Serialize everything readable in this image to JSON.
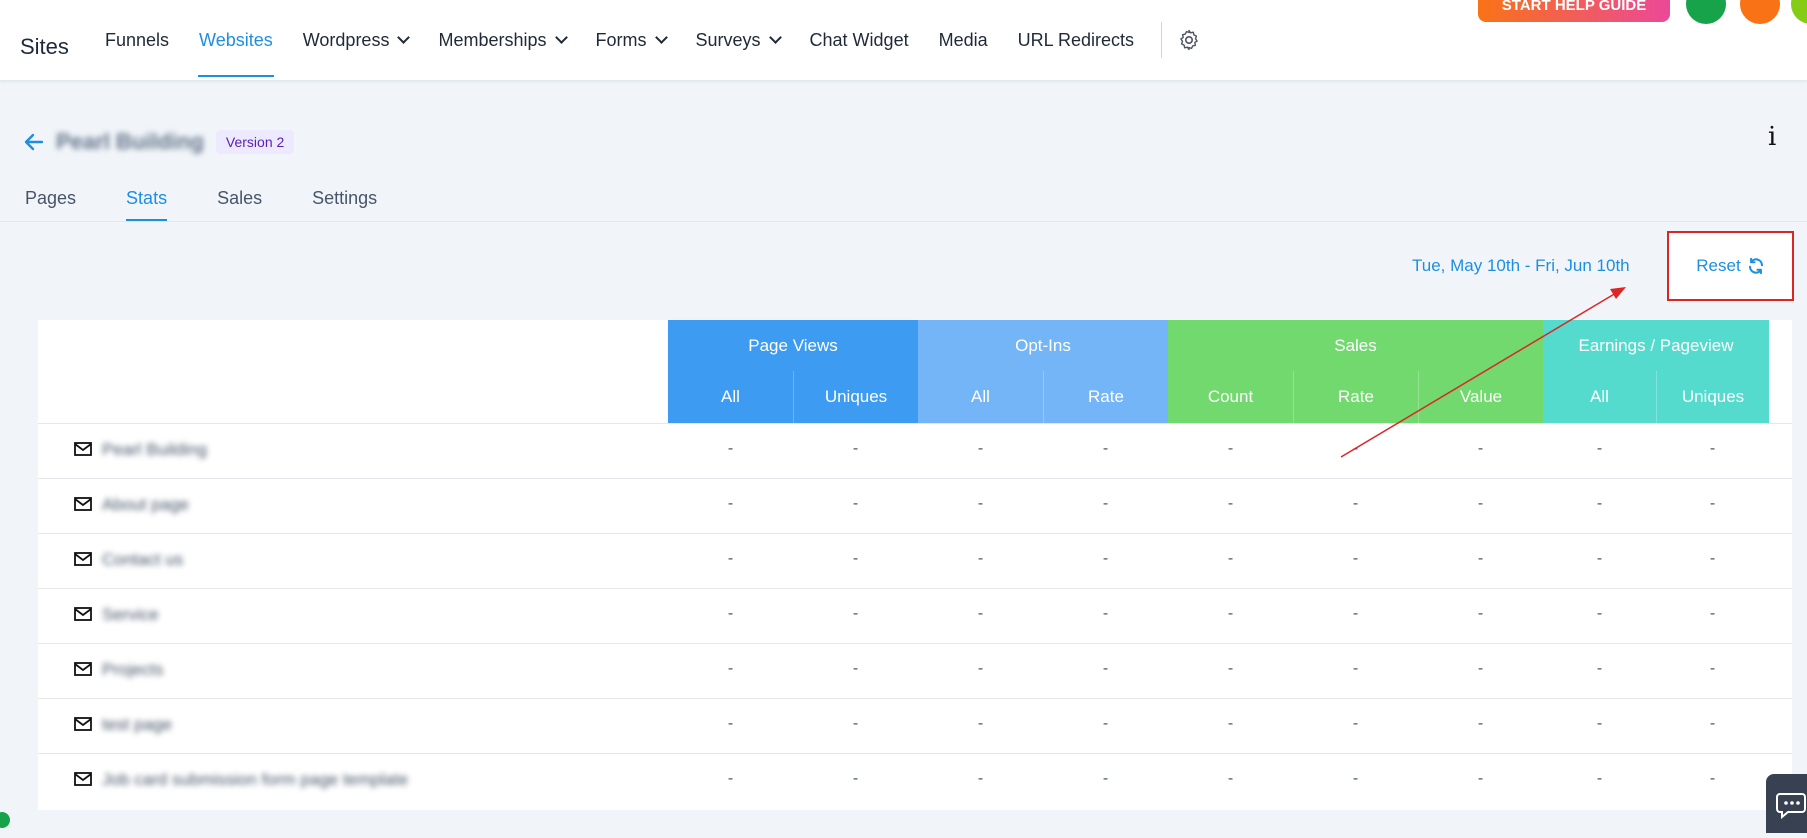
{
  "topbar": {
    "brand": "Sites",
    "nav": [
      {
        "label": "Funnels",
        "dropdown": false,
        "active": false
      },
      {
        "label": "Websites",
        "dropdown": false,
        "active": true
      },
      {
        "label": "Wordpress",
        "dropdown": true,
        "active": false
      },
      {
        "label": "Memberships",
        "dropdown": true,
        "active": false
      },
      {
        "label": "Forms",
        "dropdown": true,
        "active": false
      },
      {
        "label": "Surveys",
        "dropdown": true,
        "active": false
      },
      {
        "label": "Chat Widget",
        "dropdown": false,
        "active": false
      },
      {
        "label": "Media",
        "dropdown": false,
        "active": false
      },
      {
        "label": "URL Redirects",
        "dropdown": false,
        "active": false
      }
    ],
    "help_button": "START HELP GUIDE",
    "icons": [
      "gear-icon",
      "phone-icon",
      "list-icon"
    ]
  },
  "header": {
    "site_name": "Pearl Building",
    "version_badge": "Version 2",
    "info_label": "i"
  },
  "tabs": [
    {
      "label": "Pages",
      "active": false
    },
    {
      "label": "Stats",
      "active": true
    },
    {
      "label": "Sales",
      "active": false
    },
    {
      "label": "Settings",
      "active": false
    }
  ],
  "stats": {
    "date_range": "Tue, May 10th - Fri, Jun 10th",
    "reset_label": "Reset",
    "groups": [
      {
        "label": "Page Views",
        "color": "#3d9bf1",
        "sub": [
          "All",
          "Uniques"
        ]
      },
      {
        "label": "Opt-Ins",
        "color": "#73b5f7",
        "sub": [
          "All",
          "Rate"
        ]
      },
      {
        "label": "Sales",
        "color": "#72d96f",
        "sub": [
          "Count",
          "Rate",
          "Value"
        ]
      },
      {
        "label": "Earnings / Pageview",
        "color": "#55dbcd",
        "sub": [
          "All",
          "Uniques"
        ]
      }
    ],
    "rows": [
      {
        "name": "Pearl Building",
        "values": [
          "-",
          "-",
          "-",
          "-",
          "-",
          "-",
          "-",
          "-",
          "-"
        ]
      },
      {
        "name": "About page",
        "values": [
          "-",
          "-",
          "-",
          "-",
          "-",
          "-",
          "-",
          "-",
          "-"
        ]
      },
      {
        "name": "Contact us",
        "values": [
          "-",
          "-",
          "-",
          "-",
          "-",
          "-",
          "-",
          "-",
          "-"
        ]
      },
      {
        "name": "Service",
        "values": [
          "-",
          "-",
          "-",
          "-",
          "-",
          "-",
          "-",
          "-",
          "-"
        ]
      },
      {
        "name": "Projects",
        "values": [
          "-",
          "-",
          "-",
          "-",
          "-",
          "-",
          "-",
          "-",
          "-"
        ]
      },
      {
        "name": "test page",
        "values": [
          "-",
          "-",
          "-",
          "-",
          "-",
          "-",
          "-",
          "-",
          "-"
        ]
      },
      {
        "name": "Job card submission form page template",
        "values": [
          "-",
          "-",
          "-",
          "-",
          "-",
          "-",
          "-",
          "-",
          "-"
        ]
      }
    ]
  },
  "annotation": {
    "color": "#dc2626"
  }
}
